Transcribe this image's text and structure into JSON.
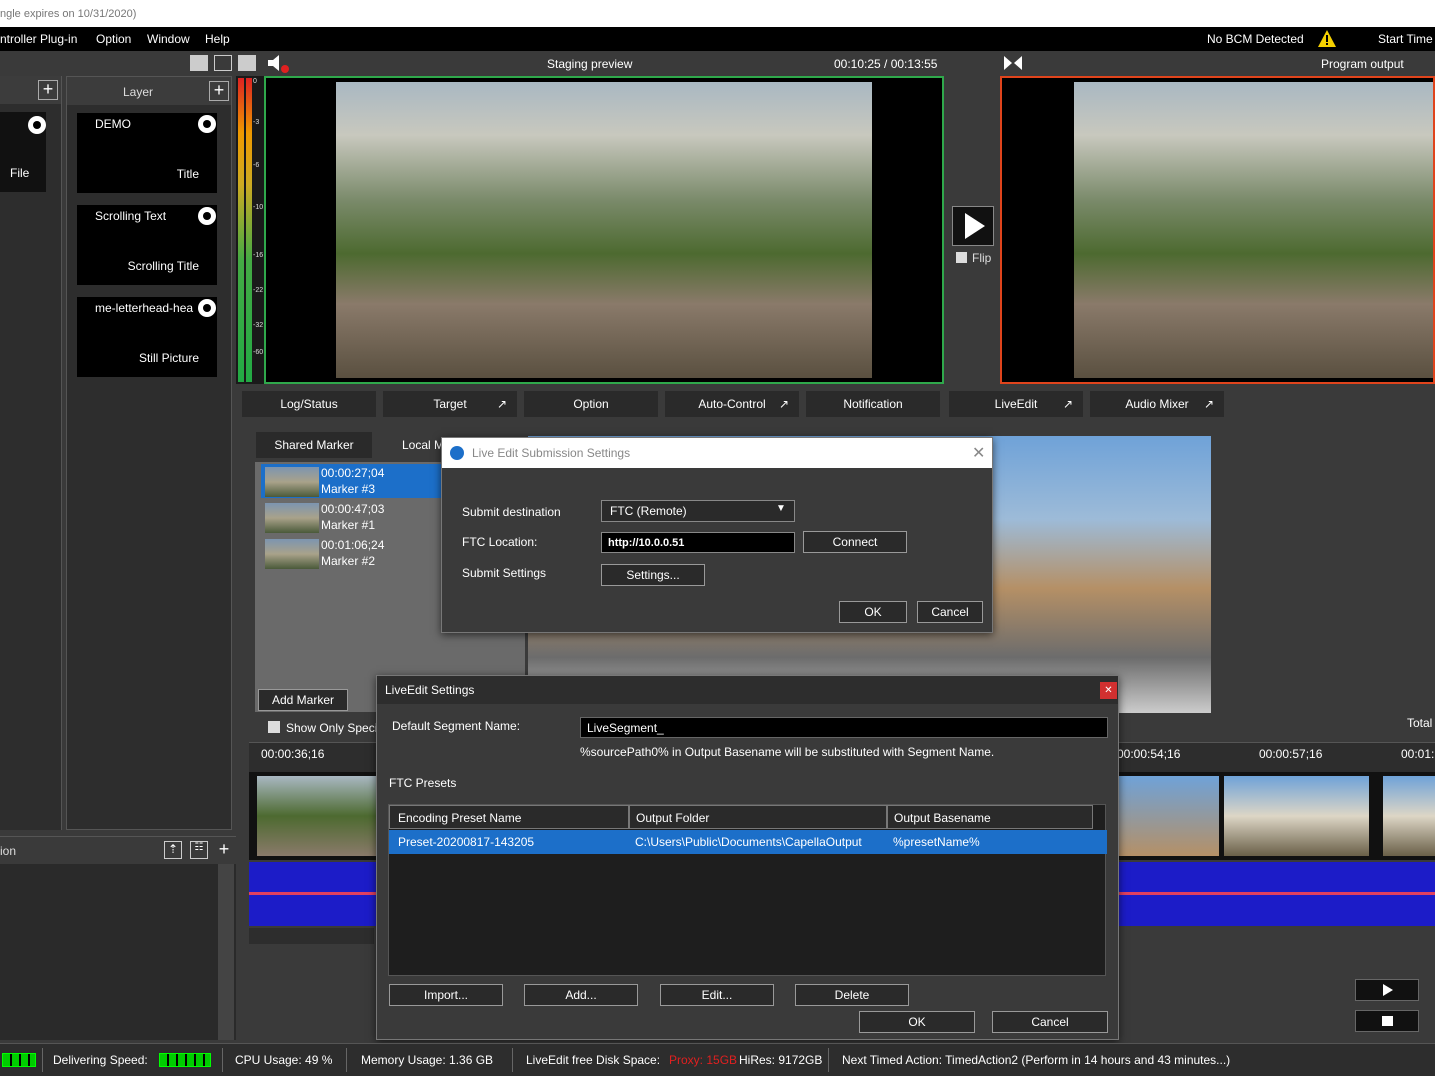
{
  "title_bar": {
    "text": "ngle expires on 10/31/2020)"
  },
  "menu": {
    "items": [
      "ntroller Plug-in",
      "Option",
      "Window",
      "Help"
    ],
    "bcm_status": "No BCM Detected",
    "start_time": "Start Time"
  },
  "left_panel": {
    "file_label": "File"
  },
  "layer_panel": {
    "header": "Layer",
    "layers": [
      {
        "name": "DEMO",
        "type": "Title"
      },
      {
        "name": "Scrolling Text",
        "type": "Scrolling Title"
      },
      {
        "name": "me-letterhead-hea",
        "type": "Still Picture"
      }
    ]
  },
  "meter": {
    "ticks": [
      "0",
      "-3",
      "-6",
      "-10",
      "-16",
      "-22",
      "-32",
      "-60"
    ]
  },
  "staging": {
    "title": "Staging preview",
    "timecode": "00:10:25 / 00:13:55"
  },
  "program": {
    "title": "Program output"
  },
  "flip": {
    "label": "Flip"
  },
  "tabs": [
    "Log/Status",
    "Target",
    "Option",
    "Auto-Control",
    "Notification",
    "LiveEdit",
    "Audio Mixer"
  ],
  "marker_panel": {
    "tabs": [
      "Shared Marker",
      "Local M"
    ],
    "markers": [
      {
        "time": "00:00:27;04",
        "name": "Marker #3"
      },
      {
        "time": "00:00:47;03",
        "name": "Marker #1"
      },
      {
        "time": "00:01:06;24",
        "name": "Marker #2"
      }
    ],
    "add_marker": "Add Marker",
    "show_only": "Show Only Speci"
  },
  "timeline": {
    "times": [
      "00:00:36;16",
      "00:00:54;16",
      "00:00:57;16",
      "00:01:"
    ],
    "total": "Total"
  },
  "bottom_left": {
    "label": "ion"
  },
  "submission_dialog": {
    "title": "Live Edit Submission Settings",
    "destination_label": "Submit destination",
    "destination_value": "FTC (Remote)",
    "location_label": "FTC Location:",
    "location_value": "http://10.0.0.51",
    "connect": "Connect",
    "settings_label": "Submit Settings",
    "settings_button": "Settings...",
    "ok": "OK",
    "cancel": "Cancel"
  },
  "liveedit_dialog": {
    "title": "LiveEdit Settings",
    "segment_label": "Default Segment Name:",
    "segment_value": "LiveSegment_",
    "hint": "%sourcePath0% in Output Basename will be substituted with Segment Name.",
    "presets_label": "FTC Presets",
    "columns": [
      "Encoding Preset Name",
      "Output Folder",
      "Output Basename"
    ],
    "rows": [
      {
        "name": "Preset-20200817-143205",
        "folder": "C:\\Users\\Public\\Documents\\CapellaOutput",
        "basename": "%presetName%"
      }
    ],
    "import": "Import...",
    "add": "Add...",
    "edit": "Edit...",
    "delete": "Delete",
    "ok": "OK",
    "cancel": "Cancel"
  },
  "status_bar": {
    "delivering": "Delivering Speed:",
    "cpu": "CPU Usage:  49 %",
    "memory": "Memory Usage: 1.36 GB",
    "disk_label": "LiveEdit free Disk Space:",
    "proxy": "Proxy: 15GB",
    "hires": "HiRes: 9172GB",
    "next_action": "Next Timed Action:  TimedAction2 (Perform in 14 hours and 43 minutes...)"
  },
  "colors": {
    "staging_border": "#2fa84b",
    "program_border": "#e0441c",
    "selection": "#1c6fc9",
    "proxy_red": "#e02020"
  }
}
